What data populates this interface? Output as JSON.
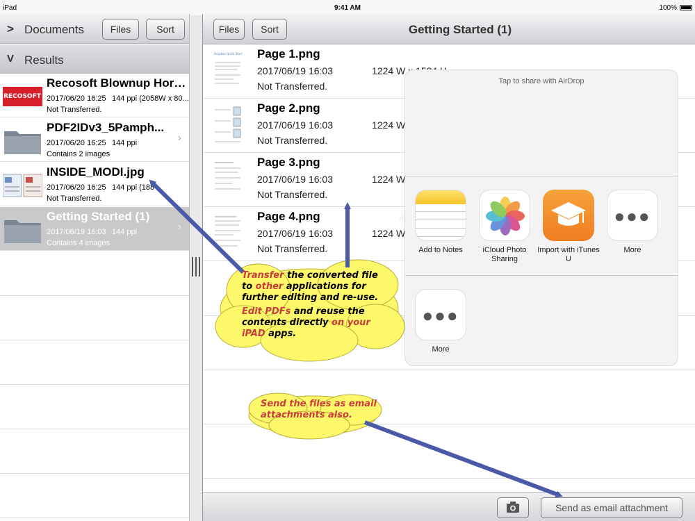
{
  "status": {
    "carrier": "iPad",
    "time": "9:41 AM",
    "battery": "100%"
  },
  "left": {
    "title": "Documents",
    "files_label": "Files",
    "sort_label": "Sort",
    "results_label": "Results",
    "items": [
      {
        "name": "Recosoft Blownup Hori...",
        "date": "2017/06/20 16:25",
        "ppi": "144 ppi (2058W x 80...",
        "status": "Not Transferred."
      },
      {
        "name": "PDF2IDv3_5Pamph...",
        "date": "2017/06/20 16:25",
        "ppi": "144 ppi",
        "status": "Contains 2 images"
      },
      {
        "name": "INSIDE_MODI.jpg",
        "date": "2017/06/20 16:25",
        "ppi": "144 ppi (188",
        "status": "Not Transferred."
      },
      {
        "name": "Getting Started (1)",
        "date": "2017/06/19 16:03",
        "ppi": "144 ppi",
        "status": "Contains 4 images"
      }
    ]
  },
  "right": {
    "files_label": "Files",
    "sort_label": "Sort",
    "title": "Getting Started (1)",
    "pages": [
      {
        "name": "Page 1.png",
        "date": "2017/06/19 16:03",
        "size": "1224 W x 1584 H",
        "status": "Not Transferred."
      },
      {
        "name": "Page 2.png",
        "date": "2017/06/19 16:03",
        "size": "1224 W",
        "status": "Not Transferred."
      },
      {
        "name": "Page 3.png",
        "date": "2017/06/19 16:03",
        "size": "1224 W",
        "status": "Not Transferred."
      },
      {
        "name": "Page 4.png",
        "date": "2017/06/19 16:03",
        "size": "1224 W",
        "status": "Not Transferred."
      }
    ],
    "email_label": "Send as email attachment"
  },
  "share": {
    "airdrop": "Tap to share with AirDrop",
    "apps": [
      {
        "label": "Add to Notes",
        "icon": "notes-icon"
      },
      {
        "label": "iCloud Photo Sharing",
        "icon": "photos-icon"
      },
      {
        "label": "Import with iTunes U",
        "icon": "itunes-u-icon"
      },
      {
        "label": "More",
        "icon": "more-icon"
      }
    ],
    "actions": [
      {
        "label": "More",
        "icon": "more-icon"
      }
    ]
  },
  "callouts": {
    "transfer": {
      "w1": "Transfer",
      "t1": " the converted file to ",
      "w2": "other",
      "t2": " applications for further editing and re-use.",
      "w3": "Edit PDFs",
      "t3": " and reuse the contents directly ",
      "w4": "on your iPAD",
      "t4": " apps."
    },
    "email": "Send the files as email attachments also."
  },
  "colors": {
    "callout_fill": "#fdf86a",
    "arrow": "#4a5aa8",
    "accent_red": "#c83c3c"
  }
}
